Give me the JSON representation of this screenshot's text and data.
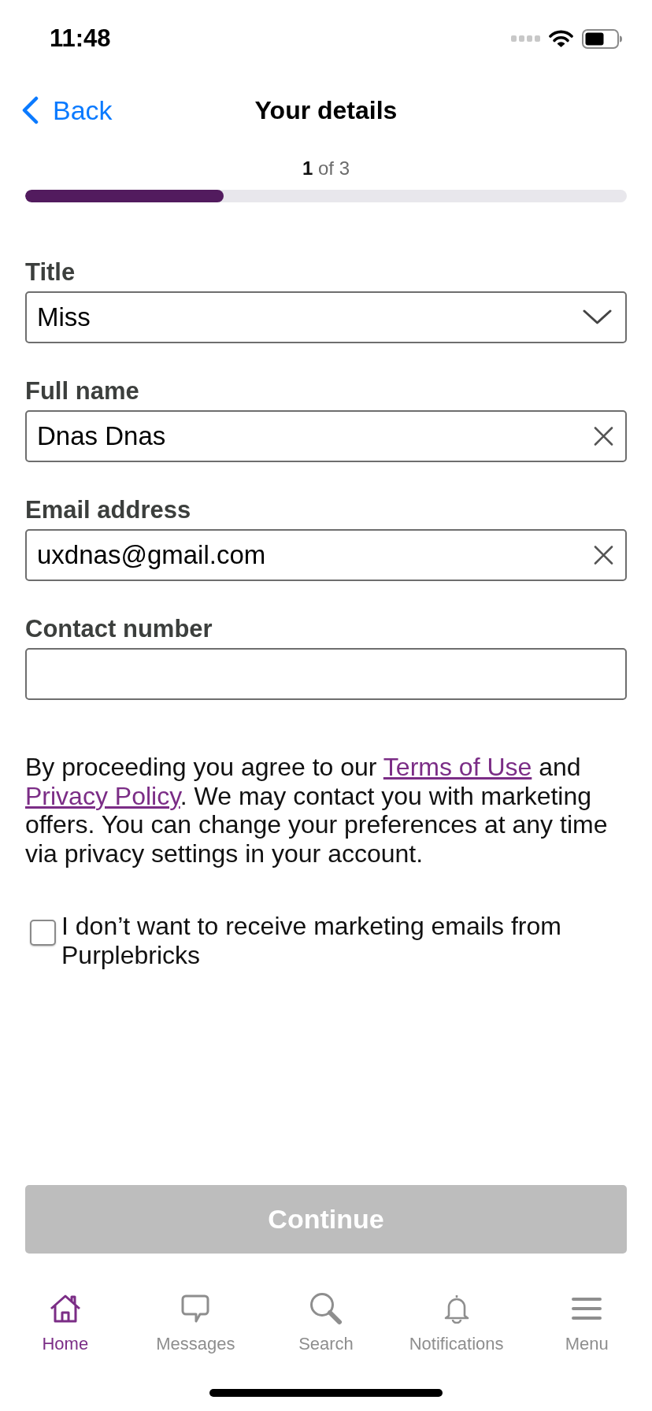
{
  "status_bar": {
    "time": "11:48"
  },
  "nav_bar": {
    "back": "Back",
    "title": "Your details"
  },
  "progress": {
    "step": "**1** of 3",
    "level": 0.33
  },
  "form": {
    "fields": [
      {
        "kind": "select",
        "label": "Title",
        "value": "Miss"
      },
      {
        "kind": "text",
        "label": "Full name",
        "value": "Dnas Dnas"
      },
      {
        "kind": "text",
        "label": "Email address",
        "value": "uxdnas@gmail.com"
      },
      {
        "kind": "text",
        "label": "Contact number"
      }
    ]
  },
  "consent": {
    "parts": [
      {
        "kind": "text",
        "text": "By proceeding you agree to our "
      },
      {
        "kind": "link",
        "text": "Terms of Use"
      },
      {
        "kind": "text",
        "text": " and "
      },
      {
        "kind": "link",
        "text": "Privacy Policy"
      },
      {
        "kind": "text",
        "text": ". We may contact you with marketing offers. You can change your preferences at any time via privacy settings in your account."
      }
    ]
  },
  "marketing_opt_out": {
    "label": "I don’t want to receive marketing emails from Purplebricks",
    "checked": false
  },
  "continue_button": {
    "label": "Continue",
    "disabled": true
  },
  "tab_bar": {
    "items": [
      {
        "label": "Home",
        "selected": true
      },
      {
        "label": "Messages",
        "selected": false
      },
      {
        "label": "Search",
        "selected": false
      },
      {
        "label": "Notifications",
        "selected": false
      },
      {
        "label": "Menu",
        "selected": false
      }
    ]
  }
}
